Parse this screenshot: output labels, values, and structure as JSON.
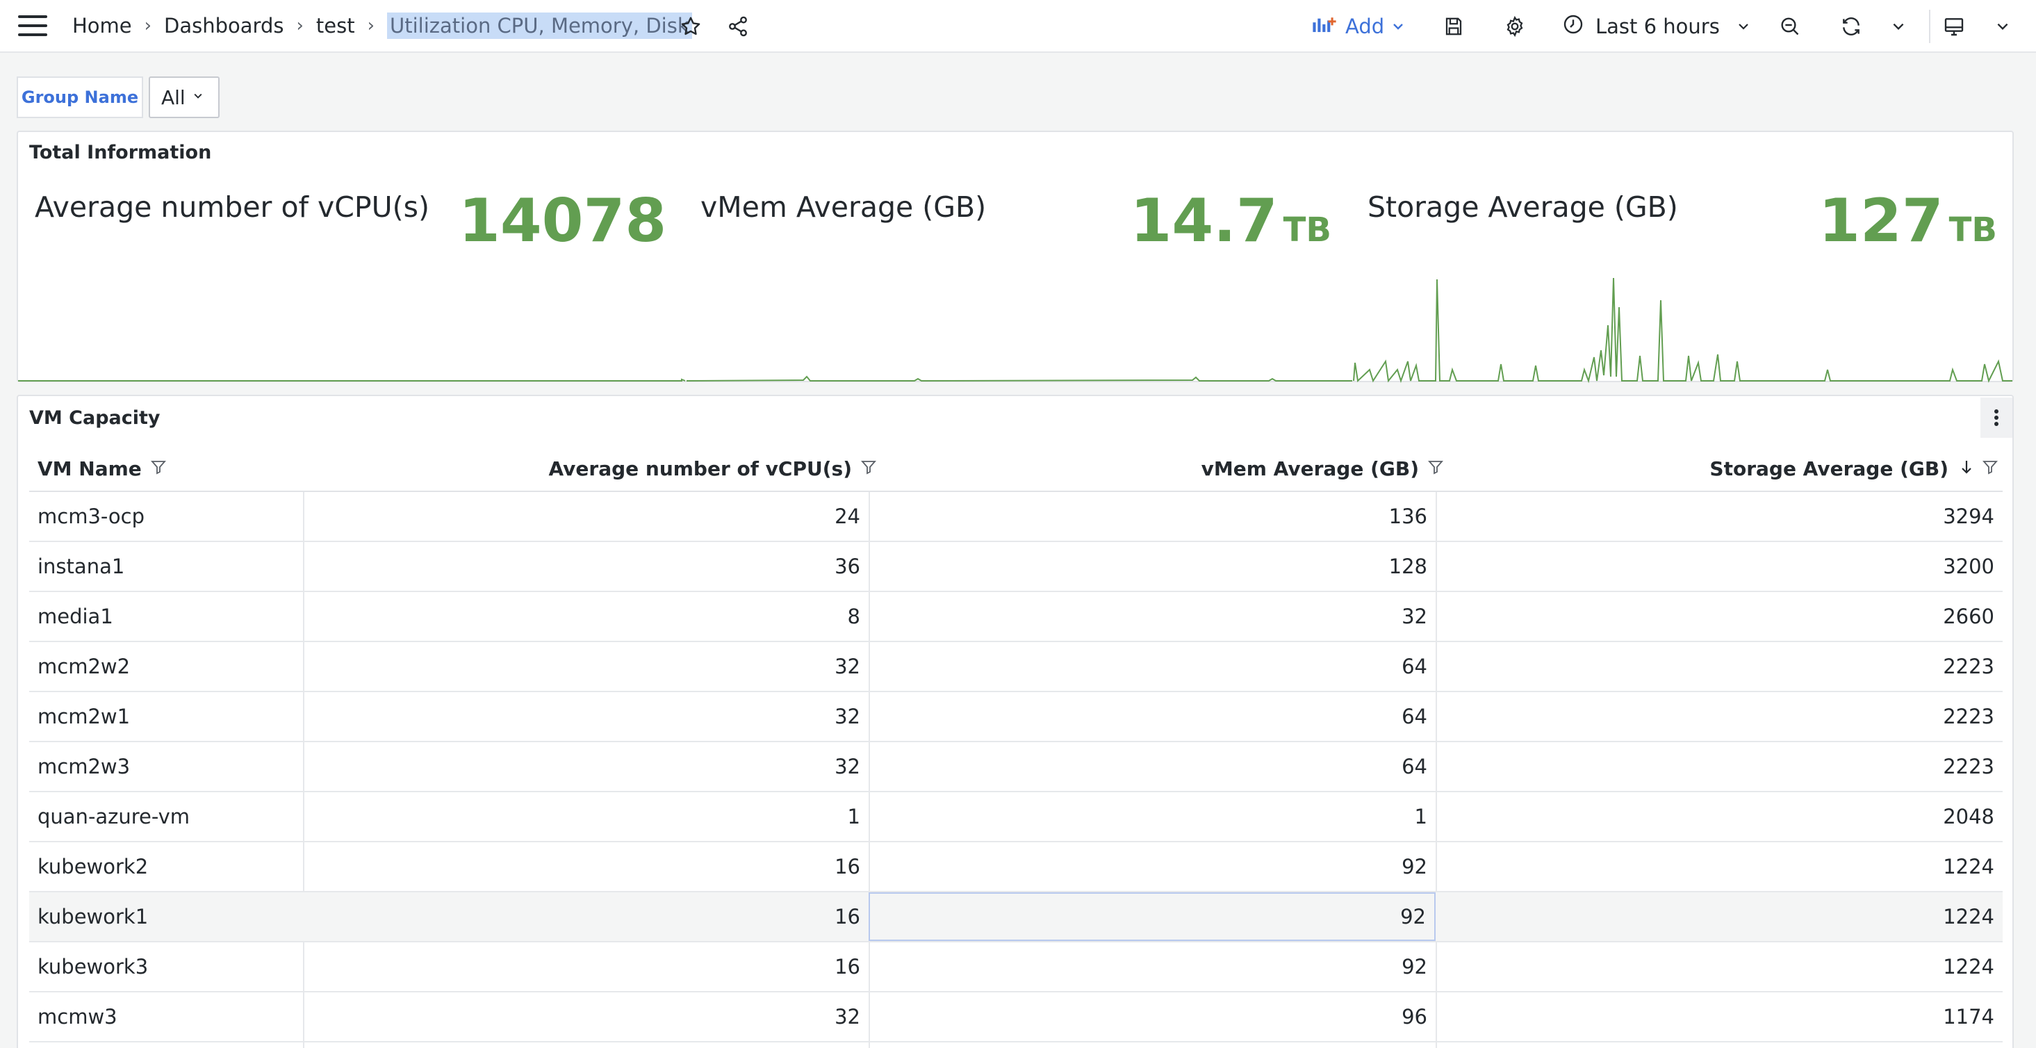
{
  "breadcrumb": {
    "home": "Home",
    "dashboards": "Dashboards",
    "folder": "test",
    "current": "Utilization CPU, Memory, Disk"
  },
  "toolbar": {
    "add_label": "Add",
    "time_range": "Last 6 hours",
    "accent_color": "#3d71d9"
  },
  "icons": [
    "menu-icon",
    "star-icon",
    "share-icon",
    "add-panel-icon",
    "save-icon",
    "gear-icon",
    "clock-icon",
    "zoom-out-icon",
    "refresh-icon",
    "tv-icon",
    "chevron-down-icon",
    "filter-icon",
    "sort-desc-icon",
    "kebab-icon"
  ],
  "variables": {
    "group_name_label": "Group Name",
    "group_name_value": "All"
  },
  "total_panel": {
    "title": "Total Information",
    "stats": [
      {
        "label": "Average number of vCPU(s)",
        "value": "14078",
        "unit": ""
      },
      {
        "label": "vMem Average (GB)",
        "value": "14.7",
        "unit": "TB"
      },
      {
        "label": "Storage Average (GB)",
        "value": "127",
        "unit": "TB"
      }
    ],
    "value_color": "#629e51"
  },
  "vm_panel": {
    "title": "VM Capacity",
    "columns": [
      "VM Name",
      "Average number of vCPU(s)",
      "vMem Average (GB)",
      "Storage Average (GB)"
    ],
    "rows": [
      [
        "mcm3-ocp",
        "24",
        "136",
        "3294"
      ],
      [
        "instana1",
        "36",
        "128",
        "3200"
      ],
      [
        "media1",
        "8",
        "32",
        "2660"
      ],
      [
        "mcm2w2",
        "32",
        "64",
        "2223"
      ],
      [
        "mcm2w1",
        "32",
        "64",
        "2223"
      ],
      [
        "mcm2w3",
        "32",
        "64",
        "2223"
      ],
      [
        "quan-azure-vm",
        "1",
        "1",
        "2048"
      ],
      [
        "kubework2",
        "16",
        "92",
        "1224"
      ],
      [
        "kubework1",
        "16",
        "92",
        "1224"
      ],
      [
        "kubework3",
        "16",
        "92",
        "1224"
      ],
      [
        "mcmw3",
        "32",
        "96",
        "1174"
      ]
    ]
  }
}
